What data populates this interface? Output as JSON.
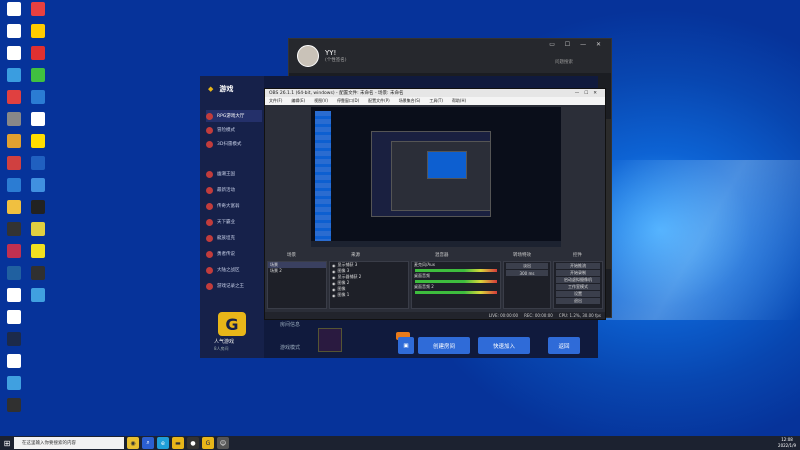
{
  "desktop_icons": [
    {
      "label": "",
      "color": "#ffffff"
    },
    {
      "label": "",
      "color": "#ffffff"
    },
    {
      "label": "",
      "color": "#ffffff"
    },
    {
      "label": "",
      "color": "#3a9de0"
    },
    {
      "label": "",
      "color": "#e04040"
    },
    {
      "label": "",
      "color": "#888888"
    },
    {
      "label": "",
      "color": "#e0a030"
    },
    {
      "label": "",
      "color": "#d04040"
    },
    {
      "label": "",
      "color": "#2b7cd3"
    },
    {
      "label": "",
      "color": "#f0c040"
    },
    {
      "label": "",
      "color": "#333333"
    },
    {
      "label": "",
      "color": "#c03050"
    },
    {
      "label": "",
      "color": "#2060a0"
    },
    {
      "label": "",
      "color": "#ffffff"
    },
    {
      "label": "",
      "color": "#ffffff"
    },
    {
      "label": "",
      "color": "#1c2a4a"
    },
    {
      "label": "",
      "color": "#ffffff"
    },
    {
      "label": "",
      "color": "#40a0e0"
    },
    {
      "label": "",
      "color": "#303030"
    },
    {
      "label": "",
      "color": "#e84040"
    },
    {
      "label": "",
      "color": "#ffcc00"
    },
    {
      "label": "",
      "color": "#e03030"
    },
    {
      "label": "",
      "color": "#40c040"
    },
    {
      "label": "",
      "color": "#2b7cd3"
    },
    {
      "label": "",
      "color": "#ffffff"
    },
    {
      "label": "",
      "color": "#ffdd00"
    },
    {
      "label": "",
      "color": "#2060c0"
    },
    {
      "label": "",
      "color": "#4090e0"
    },
    {
      "label": "",
      "color": "#222222"
    },
    {
      "label": "",
      "color": "#e0d040"
    },
    {
      "label": "",
      "color": "#f0e020"
    },
    {
      "label": "",
      "color": "#303030"
    },
    {
      "label": "",
      "color": "#40a0e0"
    }
  ],
  "chat": {
    "name": "YY!",
    "subtitle": "(个性签名)",
    "search": "问题搜索",
    "controls": "▭ ☐ — ✕"
  },
  "launcher": {
    "brand": "游戏",
    "menu": [
      {
        "label": "RPG游戏大厅",
        "active": true
      },
      {
        "label": "冒险模式",
        "active": false
      },
      {
        "label": "3D扫雷模式",
        "active": false
      },
      {
        "label": "幽潮王国",
        "active": false
      },
      {
        "label": "最新活动",
        "active": false
      },
      {
        "label": "传奇大富翁",
        "active": false
      },
      {
        "label": "天下霸业",
        "active": false
      },
      {
        "label": "龍族坦克",
        "active": false
      },
      {
        "label": "勇者传说",
        "active": false
      },
      {
        "label": "大陆之战区",
        "active": false
      },
      {
        "label": "游戏记录之王",
        "active": false
      }
    ],
    "game_name": "人气游戏",
    "game_sub": "8人房间",
    "left_label1": "房间信息",
    "left_label2": "游戏模式",
    "btn_create": "创建房间",
    "btn_quick": "快速加入",
    "btn_back": "返回"
  },
  "obs": {
    "title": "OBS 26.1.1 (64-bit, windows) - 配置文件: 未命名 - 场景: 未命名",
    "menu": [
      "文件(F)",
      "编辑(E)",
      "视图(V)",
      "停靠窗口(D)",
      "配置文件(P)",
      "场景集合(S)",
      "工具(T)",
      "帮助(H)"
    ],
    "docks": {
      "scenes": "场景",
      "sources": "来源",
      "mixer": "混音器",
      "transitions": "转场特效",
      "controls": "控件"
    },
    "scenes": [
      "场景",
      "场景 2"
    ],
    "sources": [
      "显示捕获 3",
      "图像 3",
      "显示器捕获 2",
      "图像 2",
      "图像",
      "图像 1"
    ],
    "mixer": [
      "麦克风/Aux",
      "桌面音频",
      "桌面音频 2"
    ],
    "transitions": [
      "淡出",
      "300 ms"
    ],
    "controls": [
      "开始推流",
      "开始录制",
      "启动虚拟摄像机",
      "工作室模式",
      "设置",
      "退出"
    ],
    "status": [
      "LIVE: 00:00:00",
      "REC: 00:00:00",
      "CPU: 1.2%, 30.00 fps"
    ]
  },
  "taskbar": {
    "search": "在这里输入你要搜索的内容",
    "time": "12:08",
    "date": "2022/1/9"
  }
}
